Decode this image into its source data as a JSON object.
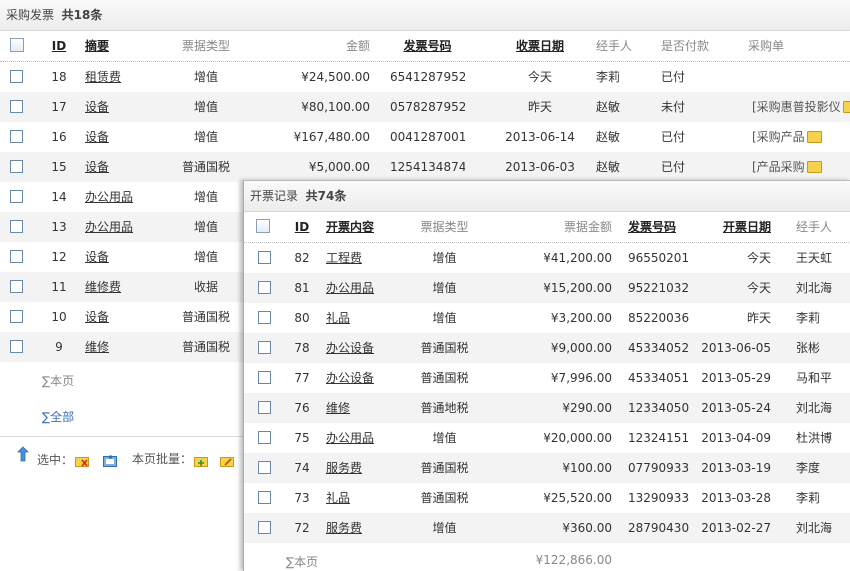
{
  "purchase_panel": {
    "title": "采购发票",
    "count_text": "共18条",
    "headers": {
      "id": "ID",
      "summary": "摘要",
      "type": "票据类型",
      "amount": "金额",
      "invoice_no": "发票号码",
      "date": "收票日期",
      "handler": "经手人",
      "paid": "是否付款",
      "purchase": "采购单"
    },
    "rows": [
      {
        "id": "18",
        "summary": "租赁费",
        "type": "增值",
        "amount": "¥24,500.00",
        "invoice_no": "6541287952",
        "date": "今天",
        "handler": "李莉",
        "paid": "已付",
        "purchase": ""
      },
      {
        "id": "17",
        "summary": "设备",
        "type": "增值",
        "amount": "¥80,100.00",
        "invoice_no": "0578287952",
        "date": "昨天",
        "handler": "赵敏",
        "paid": "未付",
        "purchase": "[采购惠普投影仪"
      },
      {
        "id": "16",
        "summary": "设备",
        "type": "增值",
        "amount": "¥167,480.00",
        "invoice_no": "0041287001",
        "date": "2013-06-14",
        "handler": "赵敏",
        "paid": "已付",
        "purchase": "[采购产品"
      },
      {
        "id": "15",
        "summary": "设备",
        "type": "普通国税",
        "amount": "¥5,000.00",
        "invoice_no": "1254134874",
        "date": "2013-06-03",
        "handler": "赵敏",
        "paid": "已付",
        "purchase": "[产品采购"
      },
      {
        "id": "14",
        "summary": "办公用品",
        "type": "增值"
      },
      {
        "id": "13",
        "summary": "办公用品",
        "type": "增值"
      },
      {
        "id": "12",
        "summary": "设备",
        "type": "增值"
      },
      {
        "id": "11",
        "summary": "维修费",
        "type": "收据"
      },
      {
        "id": "10",
        "summary": "设备",
        "type": "普通国税"
      },
      {
        "id": "9",
        "summary": "维修",
        "type": "普通国税"
      }
    ],
    "sum_page": "∑本页",
    "sum_all": "∑全部",
    "selected_label": "选中：",
    "batch_label": "本页批量："
  },
  "invoice_panel": {
    "title": "开票记录",
    "count_text": "共74条",
    "headers": {
      "id": "ID",
      "content": "开票内容",
      "type": "票据类型",
      "amount": "票据金额",
      "invoice_no": "发票号码",
      "date": "开票日期",
      "handler": "经手人"
    },
    "rows": [
      {
        "id": "82",
        "content": "工程费",
        "type": "增值",
        "amount": "¥41,200.00",
        "invoice_no": "96550201",
        "date": "今天",
        "handler": "王天虹"
      },
      {
        "id": "81",
        "content": "办公用品",
        "type": "增值",
        "amount": "¥15,200.00",
        "invoice_no": "95221032",
        "date": "今天",
        "handler": "刘北海"
      },
      {
        "id": "80",
        "content": "礼品",
        "type": "增值",
        "amount": "¥3,200.00",
        "invoice_no": "85220036",
        "date": "昨天",
        "handler": "李莉"
      },
      {
        "id": "78",
        "content": "办公设备",
        "type": "普通国税",
        "amount": "¥9,000.00",
        "invoice_no": "45334052",
        "date": "2013-06-05",
        "handler": "张彬"
      },
      {
        "id": "77",
        "content": "办公设备",
        "type": "普通国税",
        "amount": "¥7,996.00",
        "invoice_no": "45334051",
        "date": "2013-05-29",
        "handler": "马和平"
      },
      {
        "id": "76",
        "content": "维修",
        "type": "普通地税",
        "amount": "¥290.00",
        "invoice_no": "12334050",
        "date": "2013-05-24",
        "handler": "刘北海"
      },
      {
        "id": "75",
        "content": "办公用品",
        "type": "增值",
        "amount": "¥20,000.00",
        "invoice_no": "12324151",
        "date": "2013-04-09",
        "handler": "杜洪博"
      },
      {
        "id": "74",
        "content": "服务费",
        "type": "普通国税",
        "amount": "¥100.00",
        "invoice_no": "07790933",
        "date": "2013-03-19",
        "handler": "李度"
      },
      {
        "id": "73",
        "content": "礼品",
        "type": "普通国税",
        "amount": "¥25,520.00",
        "invoice_no": "13290933",
        "date": "2013-03-28",
        "handler": "李莉"
      },
      {
        "id": "72",
        "content": "服务费",
        "type": "增值",
        "amount": "¥360.00",
        "invoice_no": "28790430",
        "date": "2013-02-27",
        "handler": "刘北海"
      }
    ],
    "sum_page": "∑本页",
    "sum_value": "¥122,866.00"
  },
  "colors": {
    "link_blue": "#3a6fb0",
    "folder_yellow": "#f6d24c",
    "alt_row": "#f3f3f3"
  }
}
